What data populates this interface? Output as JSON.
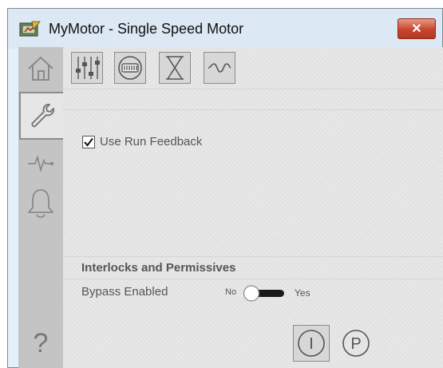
{
  "window": {
    "title": "MyMotor - Single Speed Motor",
    "close_glyph": "✕"
  },
  "sidebar": {
    "items": [
      {
        "name": "home",
        "icon": "home-icon"
      },
      {
        "name": "maintenance",
        "icon": "wrench-icon",
        "active": true
      },
      {
        "name": "trends",
        "icon": "pulse-icon"
      },
      {
        "name": "alarms",
        "icon": "bell-icon"
      }
    ],
    "help_glyph": "?"
  },
  "toolbar": {
    "icons": [
      "sliders-icon",
      "gauge-icon",
      "hourglass-icon",
      "wave-icon"
    ]
  },
  "settings": {
    "use_run_feedback_label": "Use Run Feedback",
    "use_run_feedback_checked": true
  },
  "interlocks": {
    "title": "Interlocks and Permissives",
    "bypass_label": "Bypass Enabled",
    "no_label": "No",
    "yes_label": "Yes",
    "bypass_enabled": false
  },
  "bottom_buttons": {
    "interlock_letter": "I",
    "permissive_letter": "P"
  },
  "colors": {
    "sidebar": "#c4c4c4",
    "content": "#e8e8e8",
    "close_button": "#c8442c",
    "text": "#555555"
  }
}
